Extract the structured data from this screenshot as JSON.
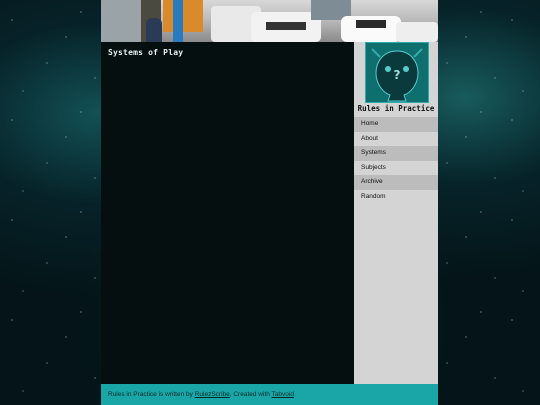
{
  "post": {
    "title": "Systems of Play"
  },
  "sidebar": {
    "site_name": "Rules in Practice",
    "avatar_icon": "ghost-mascot-icon",
    "nav": [
      {
        "label": "Home"
      },
      {
        "label": "About"
      },
      {
        "label": "Systems"
      },
      {
        "label": "Subjects"
      },
      {
        "label": "Archive"
      },
      {
        "label": "Random"
      }
    ]
  },
  "footer": {
    "prefix": "Rules in Practice is written by ",
    "author": "RulezScribe",
    "middle": ", Created with ",
    "platform": "Tabvoid"
  },
  "colors": {
    "accent": "#1aa6a6",
    "sidebar": "#d4d4d4",
    "main_bg": "#050f0f"
  }
}
